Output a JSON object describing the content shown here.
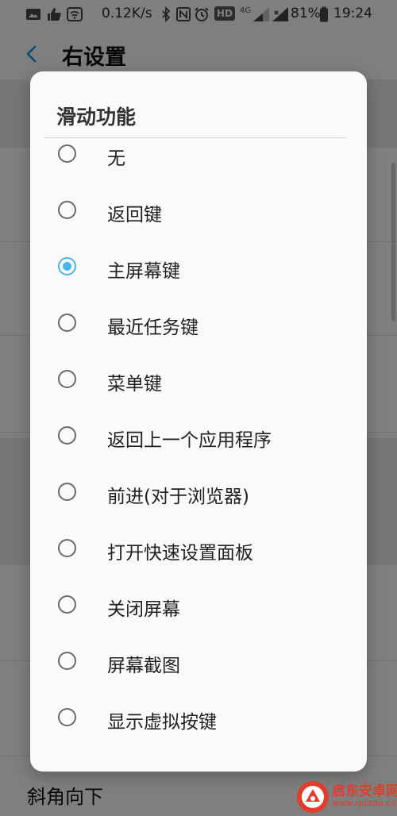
{
  "status_bar": {
    "network_speed": "0.12K/s",
    "hd_badge": "HD",
    "network_type": "4G",
    "battery_percent": "81%",
    "time": "19:24",
    "icons": [
      "image-icon",
      "thumbs-up-icon",
      "wifi-icon",
      "bluetooth-icon",
      "nfc-icon",
      "alarm-icon",
      "signal-icon",
      "battery-icon"
    ]
  },
  "header": {
    "back_icon": "chevron-left-icon",
    "title": "右设置"
  },
  "background": {
    "bottom_item": "斜角向下"
  },
  "dialog": {
    "title": "滑动功能",
    "selected_index": 2,
    "accent_color": "#4ab6e8",
    "options": [
      {
        "label": "无"
      },
      {
        "label": "返回键"
      },
      {
        "label": "主屏幕键"
      },
      {
        "label": "最近任务键"
      },
      {
        "label": "菜单键"
      },
      {
        "label": "返回上一个应用程序"
      },
      {
        "label": "前进(对于浏览器)"
      },
      {
        "label": "打开快速设置面板"
      },
      {
        "label": "关闭屏幕"
      },
      {
        "label": "屏幕截图"
      },
      {
        "label": "显示虚拟按键"
      }
    ]
  },
  "watermark": {
    "name": "启东安卓网",
    "url": "www.qdltdu.com"
  }
}
